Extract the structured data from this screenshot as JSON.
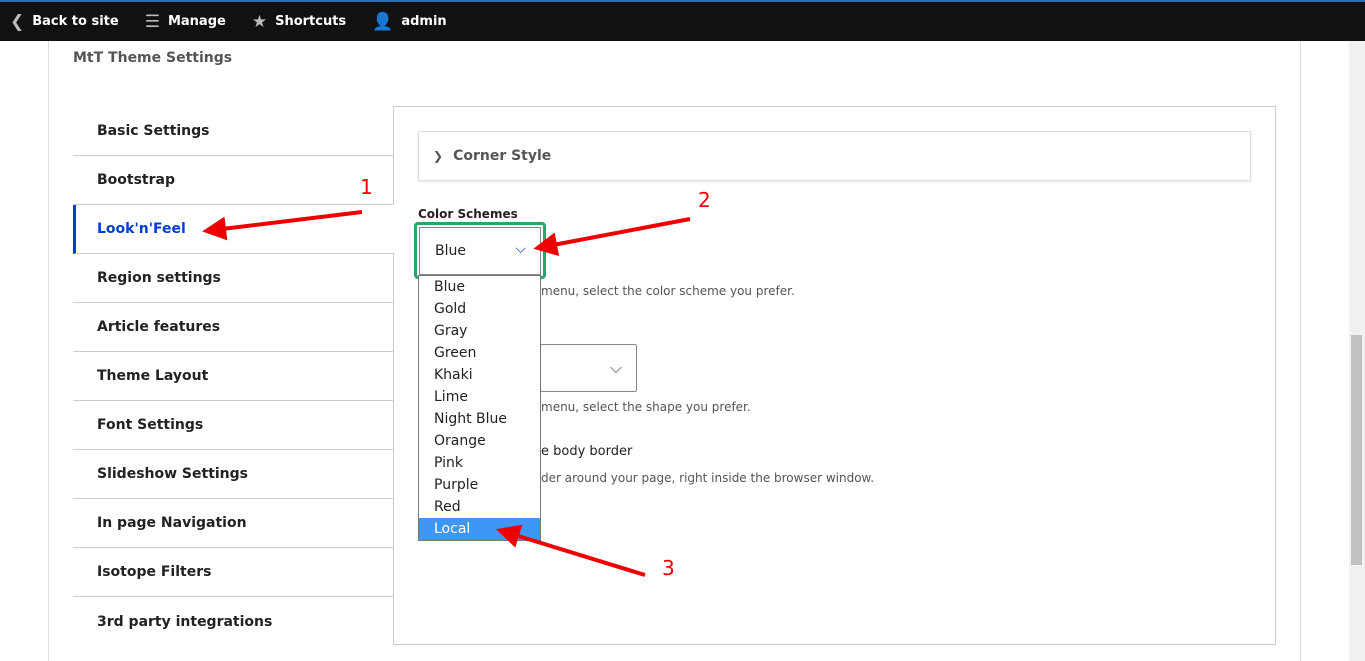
{
  "toolbar": {
    "back": "Back to site",
    "manage": "Manage",
    "shortcuts": "Shortcuts",
    "user": "admin"
  },
  "page_title": "MtT Theme Settings",
  "tabs": [
    "Basic Settings",
    "Bootstrap",
    "Look'n'Feel",
    "Region settings",
    "Article features",
    "Theme Layout",
    "Font Settings",
    "Slideshow Settings",
    "In page Navigation",
    "Isotope Filters",
    "3rd party integrations"
  ],
  "active_tab": "Look'n'Feel",
  "corner_style": "Corner Style",
  "color_schemes": {
    "label": "Color Schemes",
    "value": "Blue",
    "options": [
      "Blue",
      "Gold",
      "Gray",
      "Green",
      "Khaki",
      "Lime",
      "Night Blue",
      "Orange",
      "Pink",
      "Purple",
      "Red",
      "Local"
    ],
    "highlighted": "Local"
  },
  "descs": {
    "color": "menu, select the color scheme you prefer.",
    "shape": "menu, select the shape you prefer.",
    "border_label": "e body border",
    "border_desc": "der around your page, right inside the browser window."
  },
  "annotations": [
    "1",
    "2",
    "3"
  ],
  "colors": {
    "accent": "#003ecc",
    "focus": "#26a769",
    "highlight": "#3f96f5",
    "annotation": "#e00000"
  }
}
